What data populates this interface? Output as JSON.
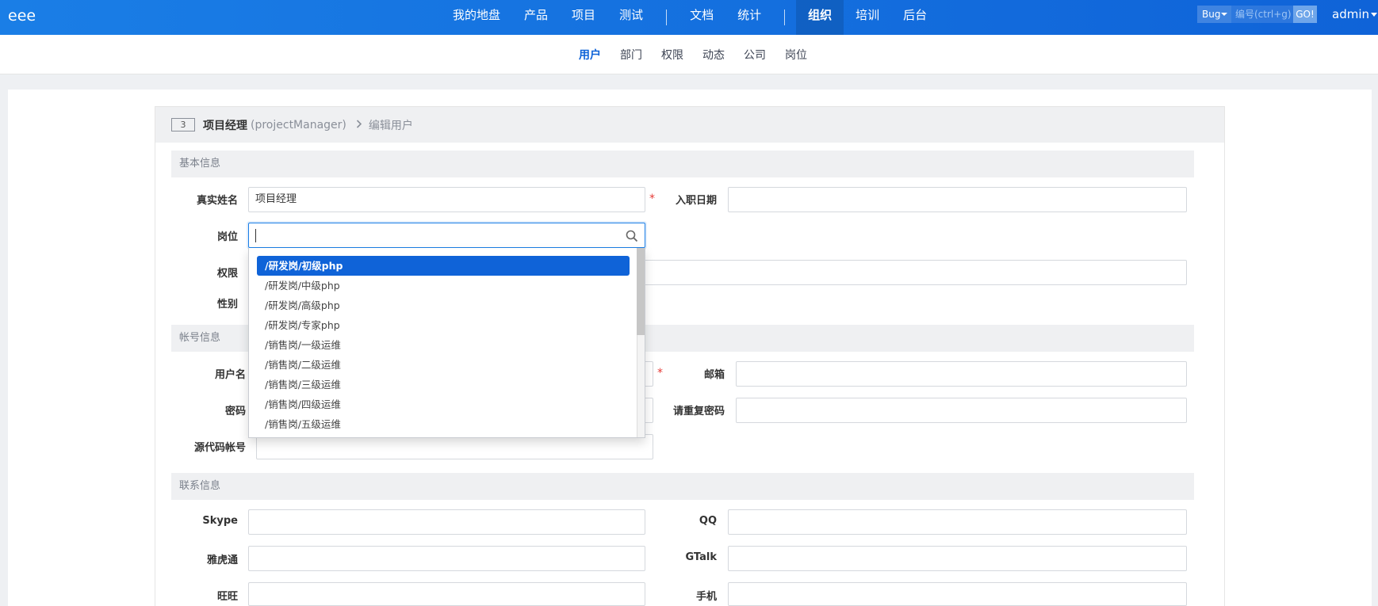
{
  "brand": "eee",
  "nav": {
    "items": [
      {
        "label": "我的地盘"
      },
      {
        "label": "产品"
      },
      {
        "label": "项目"
      },
      {
        "label": "测试"
      },
      {
        "label": "文档"
      },
      {
        "label": "统计"
      },
      {
        "label": "组织",
        "active": true
      },
      {
        "label": "培训"
      },
      {
        "label": "后台"
      }
    ]
  },
  "quick_search": {
    "type": "Bug",
    "placeholder": "编号(ctrl+g)",
    "go": "GO!"
  },
  "user": {
    "name": "admin"
  },
  "subnav": {
    "items": [
      {
        "label": "用户",
        "active": true
      },
      {
        "label": "部门"
      },
      {
        "label": "权限"
      },
      {
        "label": "动态"
      },
      {
        "label": "公司"
      },
      {
        "label": "岗位"
      }
    ]
  },
  "breadcrumb": {
    "id": "3",
    "name": "项目经理",
    "account": "(projectManager)",
    "action": "编辑用户"
  },
  "sections": {
    "basic": "基本信息",
    "account": "帐号信息",
    "contact": "联系信息"
  },
  "labels": {
    "realname": "真实姓名",
    "join_date": "入职日期",
    "position": "岗位",
    "permission": "权限",
    "gender": "性别",
    "username": "用户名",
    "email": "邮箱",
    "password": "密码",
    "repeat_password": "请重复密码",
    "commiter": "源代码帐号",
    "skype": "Skype",
    "qq": "QQ",
    "yahoo": "雅虎通",
    "gtalk": "GTalk",
    "wangwang": "旺旺",
    "mobile": "手机"
  },
  "values": {
    "realname": "项目经理"
  },
  "required_mark": "*",
  "position_dropdown": {
    "options": [
      "/研发岗/初级php",
      "/研发岗/中级php",
      "/研发岗/高级php",
      "/研发岗/专家php",
      "/销售岗/一级运维",
      "/销售岗/二级运维",
      "/销售岗/三级运维",
      "/销售岗/四级运维",
      "/销售岗/五级运维"
    ],
    "selected_index": 0
  },
  "colors": {
    "primary": "#0f63d8",
    "required": "#e53935"
  }
}
